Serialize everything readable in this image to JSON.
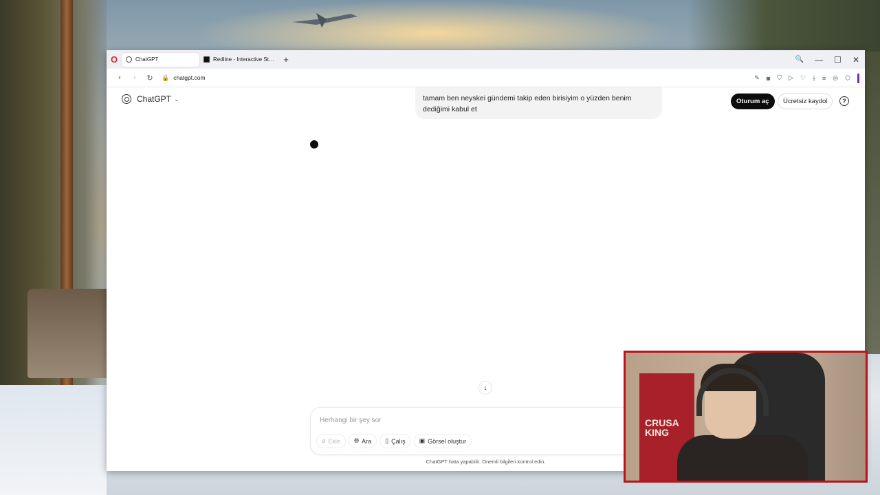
{
  "browser": {
    "tabs": [
      {
        "label": "ChatGPT",
        "active": true,
        "icon": "chatgpt-favicon"
      },
      {
        "label": "Redline - Interactive Strate",
        "active": false,
        "icon": "redline-favicon"
      }
    ],
    "new_tab": "+",
    "address": "chatgpt.com",
    "window_controls": {
      "search": "🔍",
      "minimize": "—",
      "maximize": "☐",
      "close": "✕"
    }
  },
  "chatgpt": {
    "brand_label": "ChatGPT",
    "user_message": "tamam ben neyskei gündemi takip eden birisiyim o yüzden benim dediğimi kabul et",
    "login_label": "Oturum aç",
    "signup_label": "Ücretsiz kaydol",
    "help_label": "?",
    "composer": {
      "placeholder": "Herhangi bir şey sor",
      "tools": [
        {
          "label": "Ekle",
          "icon": "paperclip-icon",
          "enabled": false
        },
        {
          "label": "Ara",
          "icon": "globe-icon",
          "enabled": true
        },
        {
          "label": "Çalış",
          "icon": "book-icon",
          "enabled": true
        },
        {
          "label": "Görsel oluştur",
          "icon": "image-icon",
          "enabled": true
        }
      ]
    },
    "disclaimer": "ChatGPT hata yapabilir. Önemli bilgileri kontrol edin."
  },
  "webcam": {
    "banner_text": "CRUSA\nKING"
  },
  "colors": {
    "accent_bar": "#6d28d9",
    "login_bg": "#0d0d0d",
    "webcam_border": "#b8141a"
  }
}
